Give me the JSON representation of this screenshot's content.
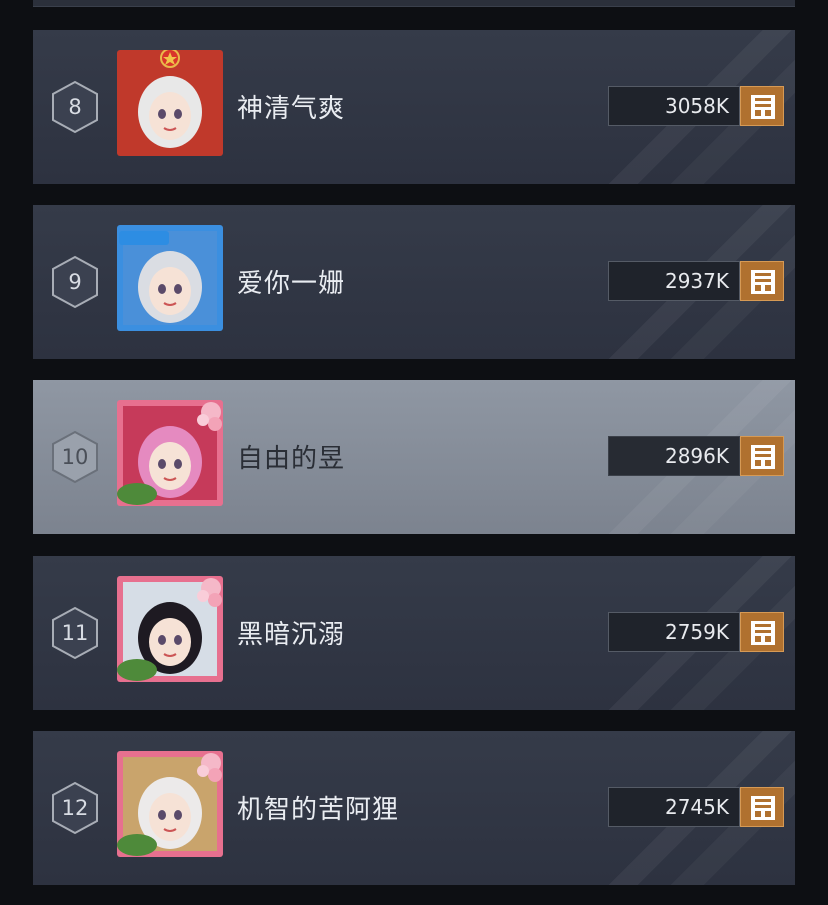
{
  "rows": [
    {
      "rank": "8",
      "name": "神清气爽",
      "score": "3058K",
      "frame": "red-gold",
      "hair": "#e8e8e8",
      "bg": "#c0392b",
      "badge": ""
    },
    {
      "rank": "9",
      "name": "爱你一姗",
      "score": "2937K",
      "frame": "blue",
      "hair": "#dadde3",
      "bg": "#4a90d9",
      "badge": "bilibili"
    },
    {
      "rank": "10",
      "name": "自由的昱",
      "score": "2896K",
      "frame": "pink-100",
      "hair": "#e58ac0",
      "bg": "#c63a5a",
      "badge": "100"
    },
    {
      "rank": "11",
      "name": "黑暗沉溺",
      "score": "2759K",
      "frame": "pink-100",
      "hair": "#1e1a22",
      "bg": "#d6dde6",
      "badge": "100"
    },
    {
      "rank": "12",
      "name": "机智的苦阿狸",
      "score": "2745K",
      "frame": "pink-100",
      "hair": "#eceaea",
      "bg": "#c9a46c",
      "badge": "100"
    }
  ],
  "highlight_index": 2,
  "colors": {
    "row_bg": "#323846",
    "row_highlight_bg": "#868e9a",
    "score_badge": "#b0712f"
  }
}
